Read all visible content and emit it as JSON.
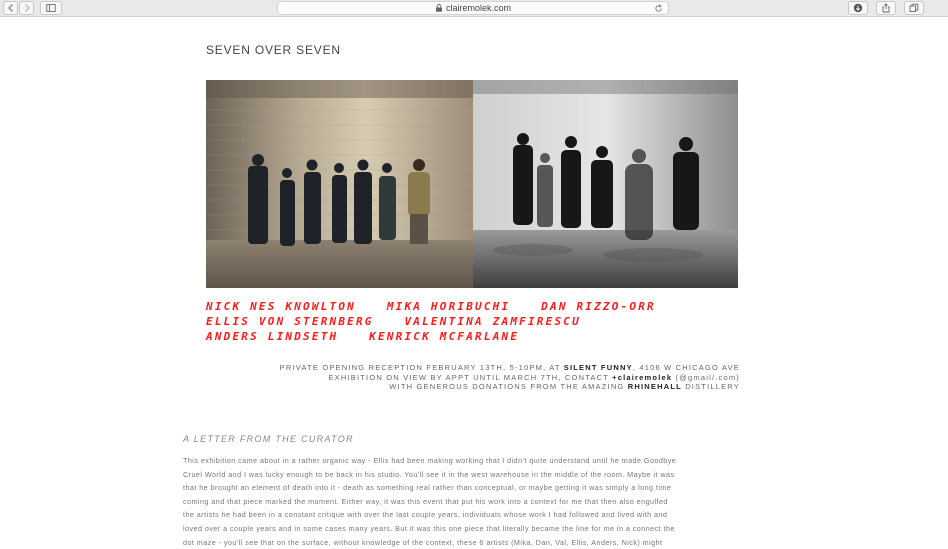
{
  "browser": {
    "url": "clairemolek.com"
  },
  "page": {
    "title": "SEVEN OVER SEVEN",
    "artists": [
      [
        "NICK NES KNOWLTON",
        "MIKA HORIBUCHI",
        "DAN RIZZO-ORR"
      ],
      [
        "ELLIS VON STERNBERG",
        "VALENTINA ZAMFIRESCU"
      ],
      [
        "ANDERS LINDSETH",
        "KENRICK MCFARLANE"
      ]
    ],
    "info": {
      "line1_pre": "PRIVATE OPENING RECEPTION FEBRUARY 13TH, 5-10PM, AT ",
      "line1_bold": "SILENT FUNNY",
      "line1_post": ", 4106 W CHICAGO AVE",
      "line2_pre": "EXHIBITION ON VIEW BY APPT UNTIL MARCH 7TH, CONTACT ",
      "line2_bold": "+clairemolek",
      "line2_post": " (@gmail/.com)",
      "line3_pre": "WITH GENEROUS DONATIONS FROM THE AMAZING ",
      "line3_bold": "RHINEHALL",
      "line3_post": " DISTILLERY"
    },
    "letter_heading": "A LETTER FROM THE CURATOR",
    "letter_lines": [
      "This exhibition came about in a rather organic way - Ellis had been making working that I didn't quite understand until he made Goodbye",
      "Cruel World and I was lucky enough to be back in his studio. You'll see it in the west warehouse in the middle of the room. Maybe it was",
      "that he brought an element of death into it - death as something real rather than conceptual, or maybe getting it was simply a long time",
      "coming and that piece marked the moment. Either way, it was this event that put his work into a context for me that then also engulfed",
      "the artists he had been in a constant critique with over the last couple years, individuals whose work I had followed and lived with and",
      "loved over a couple years and in some cases many years. But it was this one piece that literally became the line for me in a connect the",
      "dot maze - you'll see that on the surface, without knowledge of the context, these 6 artists (Mika, Dan, Val, Ellis, Anders, Nick) might"
    ]
  }
}
